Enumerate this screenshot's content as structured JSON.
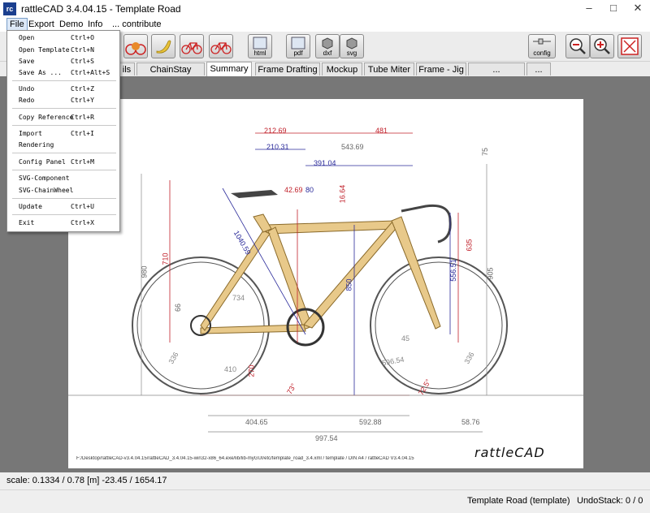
{
  "window": {
    "title": "rattleCAD  3.4.04.15 - Template Road",
    "app_icon_text": "rc"
  },
  "menubar": {
    "items": [
      "File",
      "Export",
      "Demo",
      "Info",
      "... contribute"
    ]
  },
  "file_menu": {
    "items": [
      {
        "label": "Open",
        "shortcut": "Ctrl+O"
      },
      {
        "label": "Open Template",
        "shortcut": "Ctrl+N"
      },
      {
        "label": "Save",
        "shortcut": "Ctrl+S"
      },
      {
        "label": "Save As ...",
        "shortcut": "Ctrl+Alt+S"
      },
      {
        "label": "Undo",
        "shortcut": "Ctrl+Z"
      },
      {
        "label": "Redo",
        "shortcut": "Ctrl+Y"
      },
      {
        "label": "Copy Reference",
        "shortcut": "Ctrl+R"
      },
      {
        "label": "Import",
        "shortcut": "Ctrl+I"
      },
      {
        "label": "Rendering",
        "shortcut": ""
      },
      {
        "label": "Config Panel",
        "shortcut": "Ctrl+M"
      },
      {
        "label": "SVG-Component",
        "shortcut": ""
      },
      {
        "label": "SVG-ChainWheel",
        "shortcut": ""
      },
      {
        "label": "Update",
        "shortcut": "Ctrl+U"
      },
      {
        "label": "Exit",
        "shortcut": "Ctrl+X"
      }
    ]
  },
  "toolbar": {
    "html_label": "html",
    "pdf_label": "pdf",
    "dxf_label": "dxf",
    "svg_label": "svg",
    "config_label": "config"
  },
  "tabs": [
    "ils",
    "ChainStay Details",
    "Summary",
    "Frame Drafting",
    "Mockup",
    "Tube Miter",
    "Frame - Jig",
    "... Components",
    "... info"
  ],
  "active_tab": "Summary",
  "drawing": {
    "dimensions": [
      "212.69",
      "481",
      "210.31",
      "543.69",
      "391.04",
      "42.69",
      "80",
      "16.64",
      "75",
      "710",
      "980",
      "1040.59",
      "850",
      "556.51",
      "635",
      "905",
      "66",
      "734",
      "45",
      "336",
      "336",
      "410",
      "596.54",
      "270",
      "73°",
      "72.5°",
      "404.65",
      "592.88",
      "58.76",
      "997.54"
    ],
    "footer_path": "F:/Desktop/rattleCAD-v3.4.04.15/rattleCAD_3.4.04.15-win32-x86_64.exe/lib/lib-myGUI/etc/template_road_3.4.xml   /   template   /  DIN A4  /   rattleCAD   V3.4.04.15",
    "logo_text": "rattleCAD"
  },
  "status": {
    "scale": "scale: 0.1334 / 0.78  [m]  -23.45 / 1654.17",
    "template": "Template Road (template)",
    "undo": "UndoStack:  0 / 0"
  },
  "colors": {
    "frame_tube": "#e8c98a",
    "dim_red": "#c0202a",
    "dim_blue": "#2a2a9a",
    "canvas_bg": "#777777"
  }
}
